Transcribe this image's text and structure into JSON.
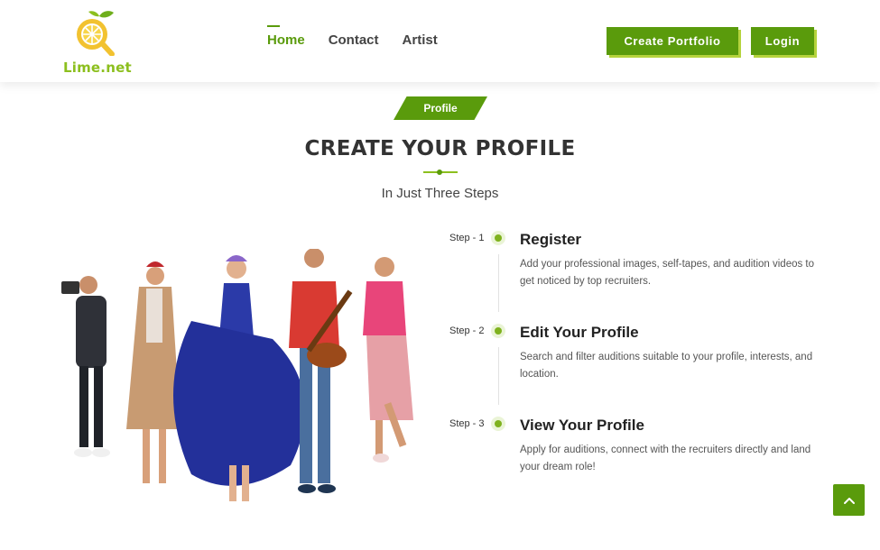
{
  "brand": {
    "name": "Lime.net",
    "accent": "#5a9b0c",
    "accent_light": "#8cbf1e"
  },
  "nav": {
    "items": [
      {
        "label": "Home",
        "active": true
      },
      {
        "label": "Contact",
        "active": false
      },
      {
        "label": "Artist",
        "active": false
      }
    ]
  },
  "header": {
    "create_portfolio_label": "Create Portfolio",
    "login_label": "Login"
  },
  "section": {
    "tag": "Profile",
    "title": "CREATE YOUR PROFILE",
    "subtitle": "In Just Three Steps"
  },
  "steps": [
    {
      "label": "Step - 1",
      "title": "Register",
      "desc": "Add your professional images, self-tapes, and audition videos to get noticed by top recruiters."
    },
    {
      "label": "Step - 2",
      "title": "Edit Your Profile",
      "desc": "Search and filter auditions suitable to your profile, interests, and location."
    },
    {
      "label": "Step - 3",
      "title": "View Your Profile",
      "desc": "Apply for auditions, connect with the recruiters directly and land your dream role!"
    }
  ],
  "icons": {
    "back_to_top": "chevron-up-icon",
    "logo": "lime-magnifier-icon"
  }
}
